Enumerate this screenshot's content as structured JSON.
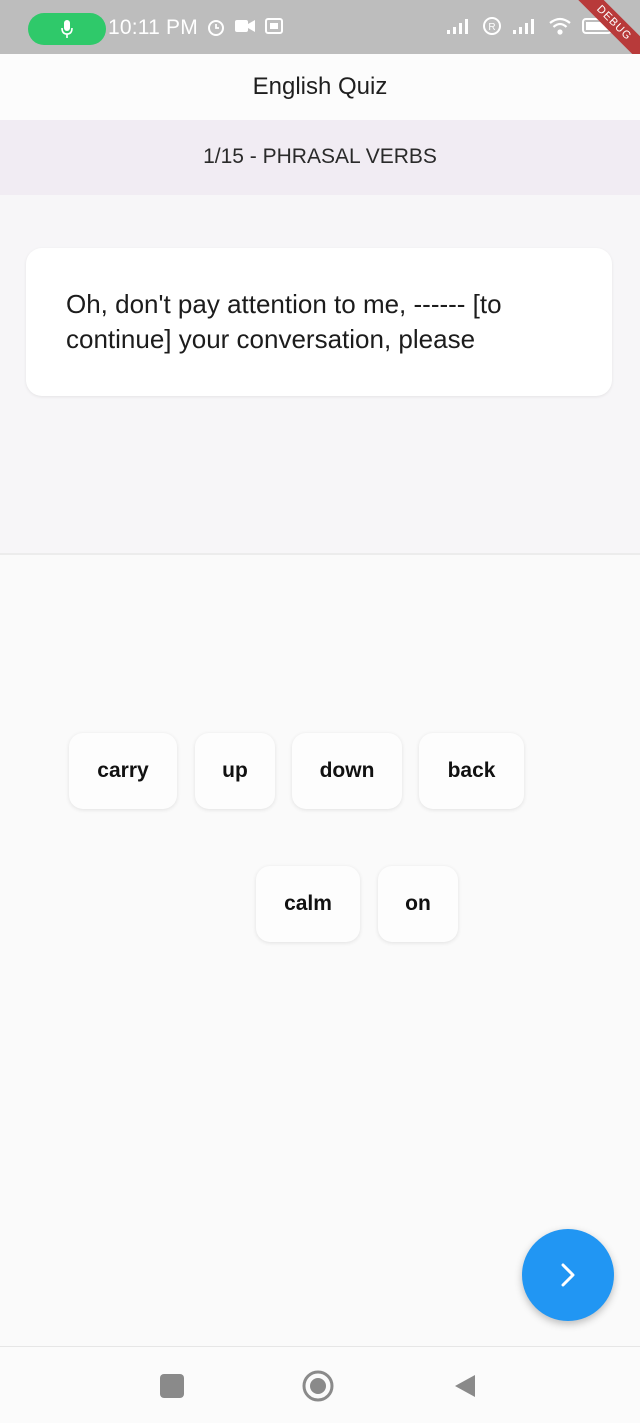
{
  "status_bar": {
    "time": "10:11 PM",
    "debug_ribbon": "DEBUG"
  },
  "app_bar": {
    "title": "English Quiz"
  },
  "quiz": {
    "category": "1/15 - PHRASAL VERBS",
    "question": "Oh, don't pay attention to me, ------ [to continue] your conversation, please"
  },
  "chips": [
    "carry",
    "up",
    "down",
    "back",
    "calm",
    "on"
  ],
  "icons": {
    "next": "chevron-right-icon",
    "recents": "square-icon",
    "home": "circle-icon",
    "back": "triangle-back-icon"
  },
  "colors": {
    "accent": "#2196f3",
    "category_band": "#f1ecf3",
    "mic_pill": "#2fc96a"
  }
}
